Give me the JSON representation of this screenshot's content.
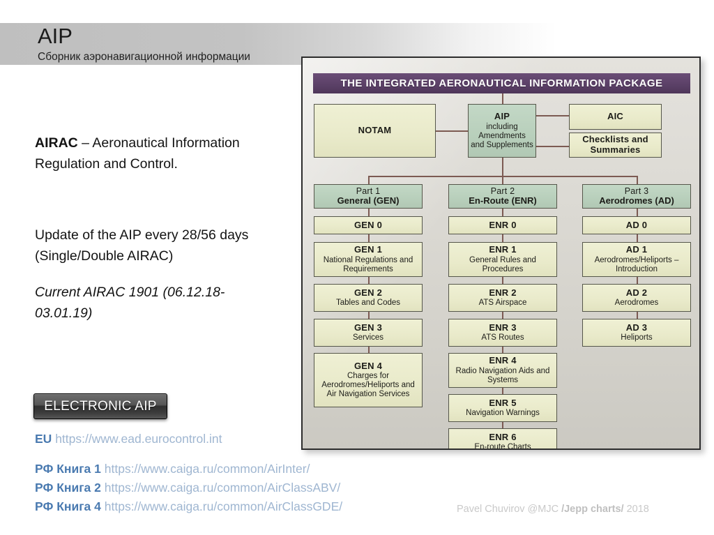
{
  "slide": {
    "title": "AIP",
    "subtitle": "Сборник аэронавигационной информации",
    "accent_gray": "#bfbfbf",
    "link_color": "#9fb6d1",
    "link_label_color": "#4a7ab0"
  },
  "body": {
    "para_airac_bold": "AIRAC",
    "para_airac_rest": " – Aeronautical Information Regulation and Control.",
    "para_update": "Update of the AIP every 28/56 days (Single/Double AIRAC)",
    "para_current": "Current AIRAC 1901 (06.12.18-03.01.19)"
  },
  "eaip": {
    "button_label": "ELECTRONIC AIP",
    "links": [
      {
        "label": "EU",
        "url": "https://www.ead.eurocontrol.int"
      },
      {
        "label": "РФ Книга 1",
        "url": "https://www.caiga.ru/common/AirInter/"
      },
      {
        "label": "РФ Книга 2",
        "url": "https://www.caiga.ru/common/AirClassABV/"
      },
      {
        "label": "РФ Книга 4",
        "url": "https://www.caiga.ru/common/AirClassGDE/"
      }
    ]
  },
  "credit": {
    "prefix": "Pavel Chuvirov @MJC ",
    "strong": "/Jepp charts/",
    "suffix": " 2018"
  },
  "diagram": {
    "banner": "THE INTEGRATED AERONAUTICAL INFORMATION PACKAGE",
    "banner_color": "#5c4168",
    "cream_color": "#eff0d2",
    "green_color": "#b9ceba",
    "top": {
      "notam": {
        "t1": "NOTAM",
        "t2": ""
      },
      "aip": {
        "t1": "AIP",
        "t2": "including Amendments and Supplements"
      },
      "aic": {
        "t1": "AIC",
        "t2": ""
      },
      "checklists": {
        "t1": "Checklists and Summaries",
        "t2": ""
      }
    },
    "parts": [
      {
        "t1": "Part 1",
        "t2": "General (GEN)"
      },
      {
        "t1": "Part 2",
        "t2": "En-Route (ENR)"
      },
      {
        "t1": "Part 3",
        "t2": "Aerodromes (AD)"
      }
    ],
    "gen": [
      {
        "t1": "GEN 0",
        "t2": ""
      },
      {
        "t1": "GEN 1",
        "t2": "National Regulations and Requirements"
      },
      {
        "t1": "GEN 2",
        "t2": "Tables and Codes"
      },
      {
        "t1": "GEN 3",
        "t2": "Services"
      },
      {
        "t1": "GEN 4",
        "t2": "Charges for Aerodromes/Heliports and Air Navigation Services"
      }
    ],
    "enr": [
      {
        "t1": "ENR 0",
        "t2": ""
      },
      {
        "t1": "ENR 1",
        "t2": "General Rules and Procedures"
      },
      {
        "t1": "ENR 2",
        "t2": "ATS Airspace"
      },
      {
        "t1": "ENR 3",
        "t2": "ATS Routes"
      },
      {
        "t1": "ENR 4",
        "t2": "Radio Navigation Aids and Systems"
      },
      {
        "t1": "ENR 5",
        "t2": "Navigation Warnings"
      },
      {
        "t1": "ENR 6",
        "t2": "En-route Charts"
      }
    ],
    "ad": [
      {
        "t1": "AD 0",
        "t2": ""
      },
      {
        "t1": "AD 1",
        "t2": "Aerodromes/Heliports – Introduction"
      },
      {
        "t1": "AD 2",
        "t2": "Aerodromes"
      },
      {
        "t1": "AD 3",
        "t2": "Heliports"
      }
    ]
  }
}
